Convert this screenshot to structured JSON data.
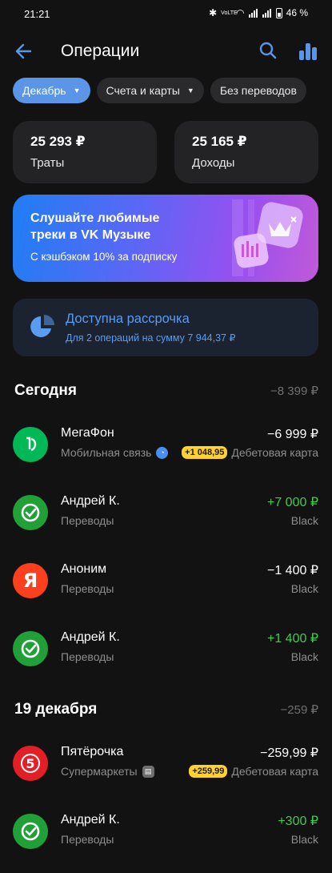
{
  "status": {
    "time": "21:21",
    "battery": "46 %",
    "net_label": "VoLTE"
  },
  "header": {
    "title": "Операции"
  },
  "filters": [
    {
      "label": "Декабрь",
      "active": true,
      "has_caret": true
    },
    {
      "label": "Счета и карты",
      "active": false,
      "has_caret": true
    },
    {
      "label": "Без переводов",
      "active": false,
      "has_caret": false
    }
  ],
  "summary": {
    "spend": {
      "amount": "25 293 ₽",
      "label": "Траты"
    },
    "income": {
      "amount": "25 165 ₽",
      "label": "Доходы"
    }
  },
  "promo": {
    "title": "Слушайте любимые треки в VK Музыке",
    "subtitle": "С кэшбэком 10% за подписку"
  },
  "installment": {
    "title": "Доступна рассрочка",
    "subtitle": "Для 2 операций на сумму 7 944,37 ₽"
  },
  "sections": [
    {
      "title": "Сегодня",
      "total": "−8 399 ₽",
      "operations": [
        {
          "name": "МегаФон",
          "category": "Мобильная связь",
          "amount": "−6 999 ₽",
          "positive": false,
          "cashback": "+1 048,95",
          "account": "Дебетовая карта",
          "logo": "megafon-logo"
        },
        {
          "name": "Андрей К.",
          "category": "Переводы",
          "amount": "+7 000 ₽",
          "positive": true,
          "account": "Black",
          "logo": "transfer-check-icon"
        },
        {
          "name": "Аноним",
          "category": "Переводы",
          "amount": "−1 400 ₽",
          "positive": false,
          "account": "Black",
          "logo": "yandex-logo"
        },
        {
          "name": "Андрей К.",
          "category": "Переводы",
          "amount": "+1 400 ₽",
          "positive": true,
          "account": "Black",
          "logo": "transfer-check-icon"
        }
      ]
    },
    {
      "title": "19 декабря",
      "total": "−259 ₽",
      "operations": [
        {
          "name": "Пятёрочка",
          "category": "Супермаркеты",
          "amount": "−259,99 ₽",
          "positive": false,
          "cashback": "+259,99",
          "account": "Дебетовая карта",
          "logo": "pyaterochka-logo"
        },
        {
          "name": "Андрей К.",
          "category": "Переводы",
          "amount": "+300 ₽",
          "positive": true,
          "account": "Black",
          "logo": "transfer-check-icon"
        }
      ]
    }
  ],
  "colors": {
    "background": "#121212",
    "accent": "#5b95e8",
    "positive": "#3fcb4f",
    "cashback_badge": "#ffd22e",
    "megafon": "#00b956",
    "yandex": "#fc3f1d",
    "pyaterochka": "#e31e24"
  }
}
